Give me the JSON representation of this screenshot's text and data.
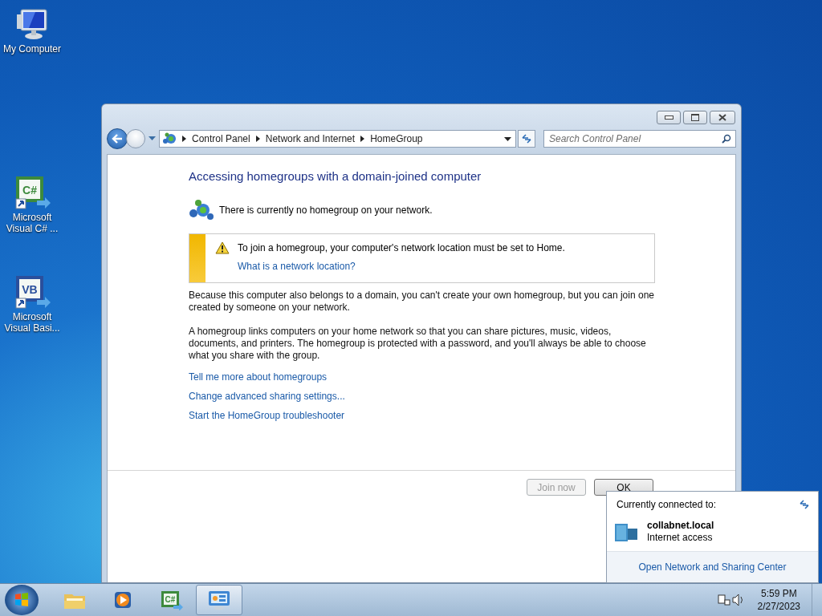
{
  "desktop_icons": [
    {
      "kind": "computer",
      "label": "My Computer"
    },
    {
      "kind": "csharp",
      "badge": "C#",
      "label": "Microsoft Visual C# ..."
    },
    {
      "kind": "vb",
      "badge": "VB",
      "label": "Microsoft Visual Basi..."
    }
  ],
  "window": {
    "breadcrumb": [
      "Control Panel",
      "Network and Internet",
      "HomeGroup"
    ],
    "search": {
      "placeholder": "Search Control Panel"
    },
    "heading": "Accessing homegroups with a domain-joined computer",
    "status": "There is currently no homegroup on your network.",
    "notice": {
      "text": "To join a homegroup, your computer's network location must be set to Home.",
      "link": "What is a network location?"
    },
    "paragraphs": [
      "Because this computer also belongs to a domain, you can't create your own homegroup, but you can join one created by someone on your network.",
      "A homegroup links computers on your home network so that you can share pictures, music, videos, documents, and printers. The homegroup is protected with a password, and you'll always be able to choose what you share with the group."
    ],
    "links": [
      "Tell me more about homegroups",
      "Change advanced sharing settings...",
      "Start the HomeGroup troubleshooter"
    ],
    "buttons": [
      {
        "label": "Join now",
        "disabled": true
      },
      {
        "label": "OK",
        "disabled": false
      }
    ]
  },
  "network_popup": {
    "title": "Currently connected to:",
    "network": "collabnet.local",
    "access": "Internet access",
    "link": "Open Network and Sharing Center"
  },
  "taskbar": {
    "items": [
      {
        "kind": "explorer",
        "selected": false
      },
      {
        "kind": "media",
        "selected": false
      },
      {
        "kind": "csharp",
        "badge": "C#",
        "selected": false
      },
      {
        "kind": "control-panel",
        "selected": true
      }
    ],
    "time": "5:59 PM",
    "date": "2/27/2023"
  }
}
